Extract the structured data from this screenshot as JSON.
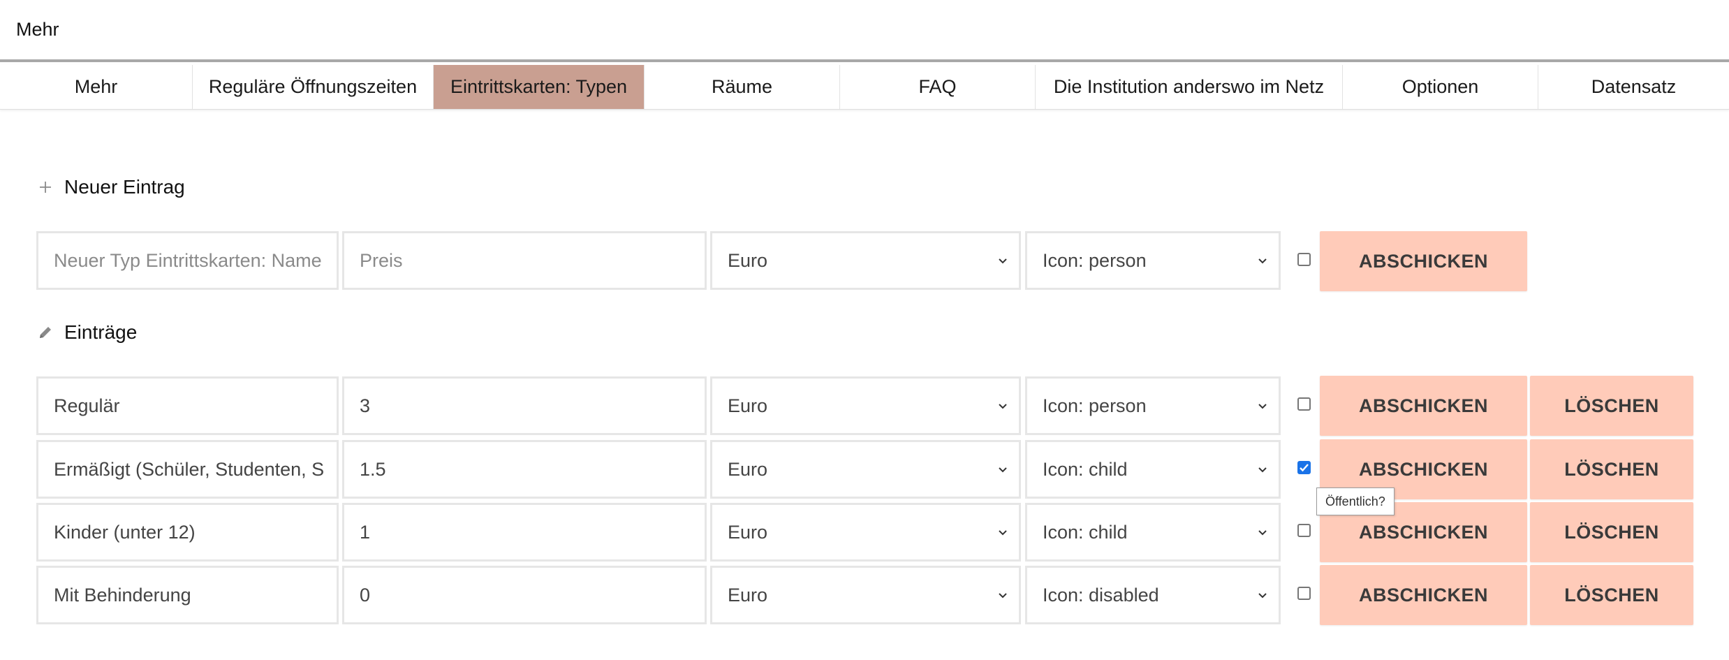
{
  "header": {
    "title": "Mehr"
  },
  "tabs": [
    {
      "label": "Mehr"
    },
    {
      "label": "Reguläre Öffnungszeiten"
    },
    {
      "label": "Eintrittskarten: Typen"
    },
    {
      "label": "Räume"
    },
    {
      "label": "FAQ"
    },
    {
      "label": "Die Institution anderswo im Netz"
    },
    {
      "label": "Optionen"
    },
    {
      "label": "Datensatz"
    }
  ],
  "active_tab_color": "#c99f91",
  "button_color": "#ffcbb9",
  "new_entry": {
    "heading": "Neuer Eintrag",
    "name_placeholder": "Neuer Typ Eintrittskarten: Name",
    "price_placeholder": "Preis",
    "currency": "Euro",
    "icon": "Icon: person",
    "public": false,
    "submit_label": "ABSCHICKEN"
  },
  "entries_heading": "Einträge",
  "entries": [
    {
      "name": "Regulär",
      "price": "3",
      "currency": "Euro",
      "icon": "Icon: person",
      "public": false,
      "submit_label": "ABSCHICKEN",
      "delete_label": "LÖSCHEN"
    },
    {
      "name": "Ermäßigt (Schüler, Studenten, S",
      "price": "1.5",
      "currency": "Euro",
      "icon": "Icon: child",
      "public": true,
      "submit_label": "ABSCHICKEN",
      "delete_label": "LÖSCHEN"
    },
    {
      "name": "Kinder (unter 12)",
      "price": "1",
      "currency": "Euro",
      "icon": "Icon: child",
      "public": false,
      "submit_label": "ABSCHICKEN",
      "delete_label": "LÖSCHEN"
    },
    {
      "name": "Mit Behinderung",
      "price": "0",
      "currency": "Euro",
      "icon": "Icon: disabled",
      "public": false,
      "submit_label": "ABSCHICKEN",
      "delete_label": "LÖSCHEN"
    }
  ],
  "tooltip": "Öffentlich?"
}
